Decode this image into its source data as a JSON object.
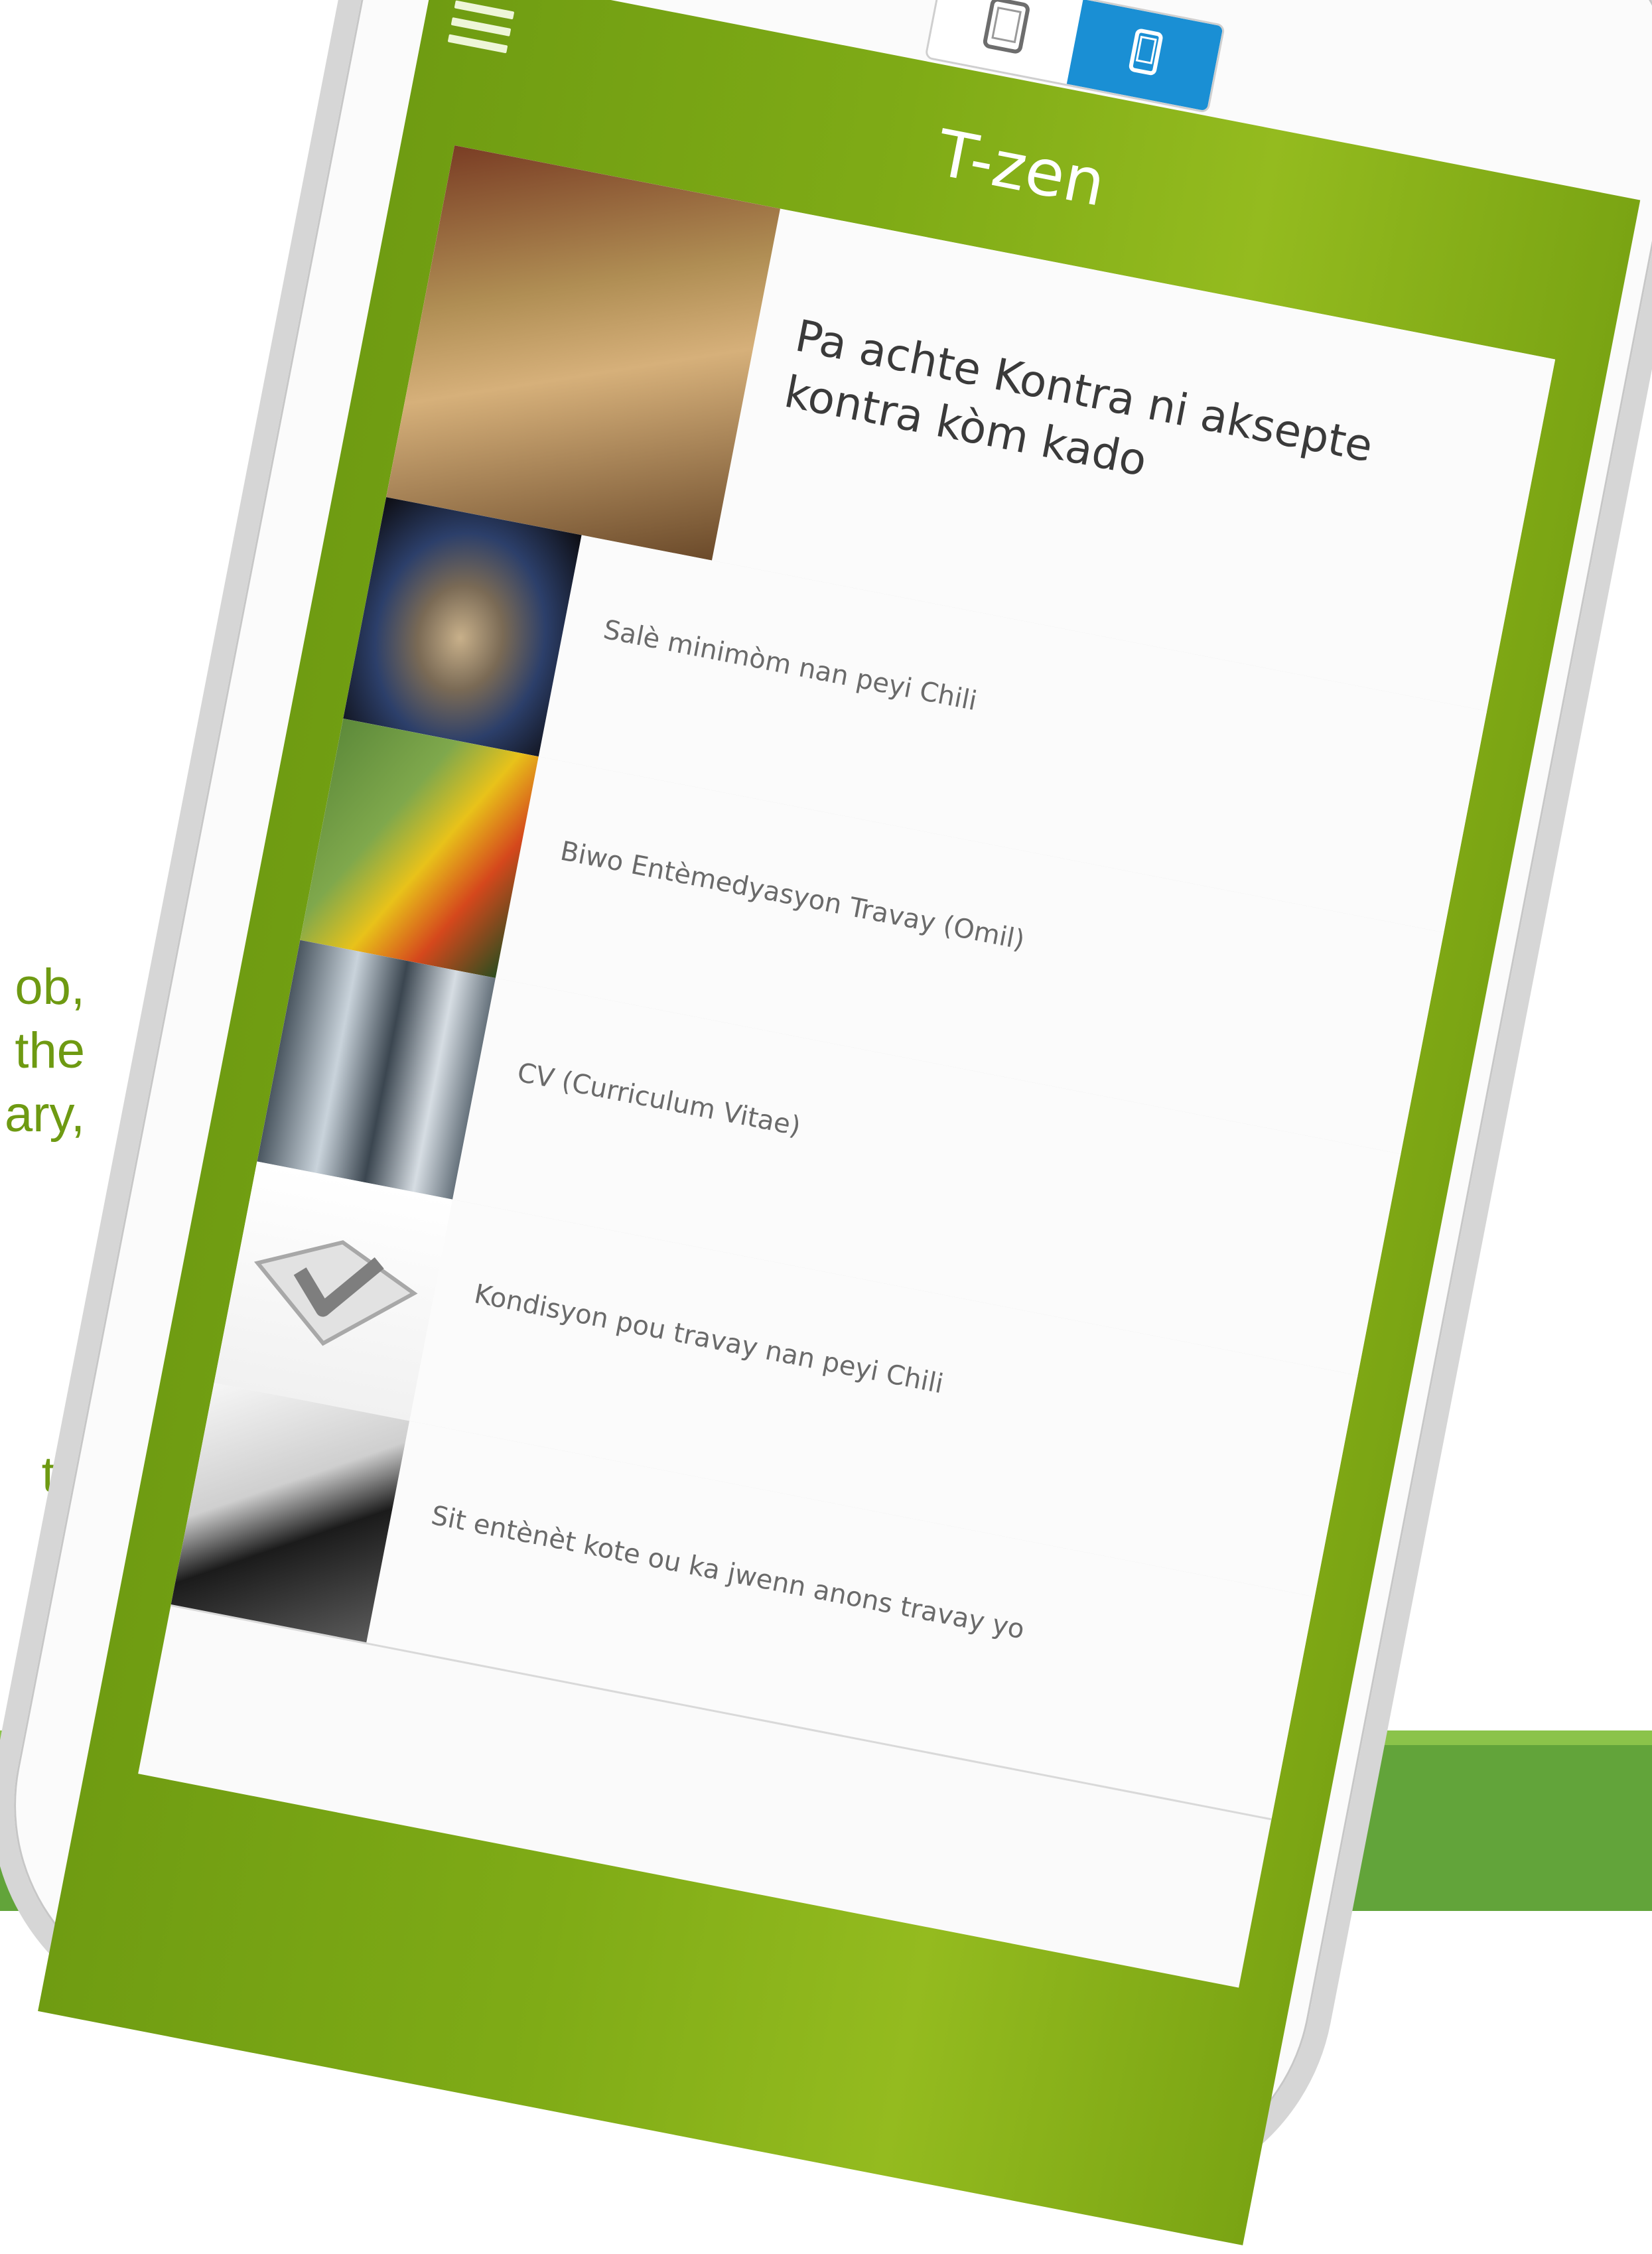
{
  "slide": {
    "text_fragments": [
      "ob,",
      "the",
      "ary,",
      "to"
    ]
  },
  "device_toggle": {
    "tablet_icon": "tablet-icon",
    "mobile_icon": "mobile-icon",
    "active": "mobile",
    "active_color": "#1a8fd4"
  },
  "app": {
    "title": "T-zen",
    "menu_icon": "hamburger-menu-icon",
    "header_color": "#7aa413"
  },
  "articles": [
    {
      "title": "Pa achte Kontra ni aksepte kontra kòm kado",
      "image": "contract-signing-photo"
    },
    {
      "title": "Salè minimòm nan peyi Chili",
      "image": "coins-photo"
    },
    {
      "title": "Biwo Entèmedyasyon Travay (Omil)",
      "image": "hard-hat-photo"
    },
    {
      "title": "CV (Curriculum Vitae)",
      "image": "job-candidates-photo"
    },
    {
      "title": "Kondisyon pou travay nan peyi Chili",
      "image": "checkmark-photo"
    },
    {
      "title": "Sit entènèt kote ou ka jwenn anons travay yo",
      "image": "typing-hand-photo"
    }
  ]
}
